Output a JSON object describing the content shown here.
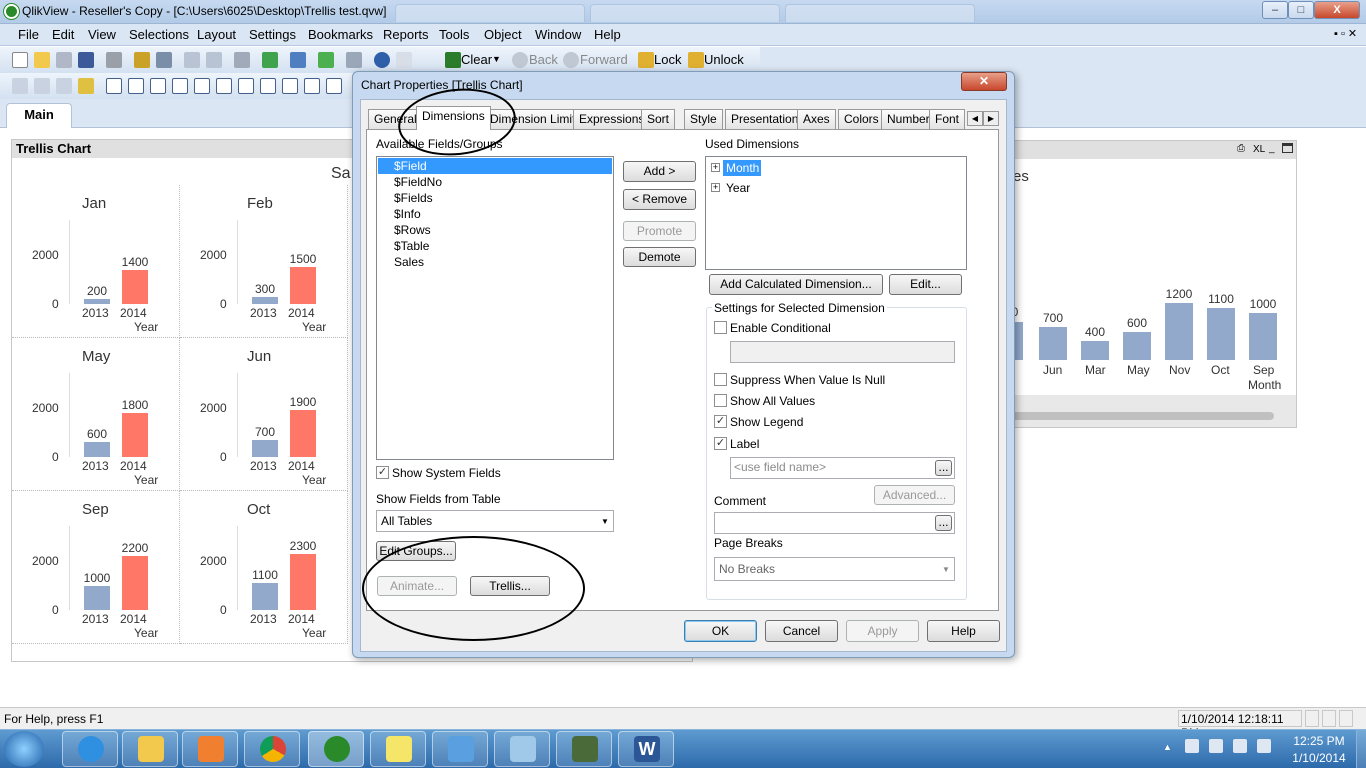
{
  "window": {
    "title": "QlikView - Reseller's Copy - [C:\\Users\\6025\\Desktop\\Trellis test.qvw]",
    "controls": {
      "minimize": "–",
      "maximize": "□",
      "close": "X"
    }
  },
  "menu": [
    "File",
    "Edit",
    "View",
    "Selections",
    "Layout",
    "Settings",
    "Bookmarks",
    "Reports",
    "Tools",
    "Object",
    "Window",
    "Help"
  ],
  "toolbar": {
    "clear": "Clear",
    "back": "Back",
    "forward": "Forward",
    "lock": "Lock",
    "unlock": "Unlock"
  },
  "sheet_tabs": [
    "Main"
  ],
  "trellis_object": {
    "title": "Trellis Chart",
    "partial_heading": "Sa",
    "x_axis_title": "Year",
    "cells": [
      {
        "month": "Jan",
        "values": [
          200,
          1400
        ]
      },
      {
        "month": "Feb",
        "values": [
          300,
          1500
        ]
      },
      {
        "month": "May",
        "values": [
          600,
          1800
        ]
      },
      {
        "month": "Jun",
        "values": [
          700,
          1900
        ]
      },
      {
        "month": "Sep",
        "values": [
          1000,
          2200
        ]
      },
      {
        "month": "Oct",
        "values": [
          1100,
          2300
        ]
      }
    ]
  },
  "chart_data": [
    {
      "type": "bar",
      "title": "Trellis Chart",
      "xlabel": "Year",
      "ylabel": "",
      "categories": [
        "2013",
        "2014"
      ],
      "y_ticks": [
        "0",
        "2000"
      ],
      "ylim": [
        0,
        2500
      ],
      "panels": [
        {
          "label": "Jan",
          "values": [
            200,
            1400
          ]
        },
        {
          "label": "Feb",
          "values": [
            300,
            1500
          ]
        },
        {
          "label": "May",
          "values": [
            600,
            1800
          ]
        },
        {
          "label": "Jun",
          "values": [
            700,
            1900
          ]
        },
        {
          "label": "Sep",
          "values": [
            1000,
            2200
          ]
        },
        {
          "label": "Oct",
          "values": [
            1100,
            2300
          ]
        }
      ]
    },
    {
      "type": "bar",
      "title": "",
      "partial_title": "es",
      "xlabel": "Month",
      "ylabel": "",
      "categories": [
        "l",
        "Jun",
        "Mar",
        "May",
        "Nov",
        "Oct",
        "Sep"
      ],
      "values": [
        null,
        700,
        400,
        600,
        1200,
        1100,
        1000
      ],
      "value_labels": [
        "0",
        "700",
        "400",
        "600",
        "1200",
        "1100",
        "1000"
      ],
      "ylim": [
        0,
        1500
      ]
    }
  ],
  "right_chart_header": {
    "xl": "XL"
  },
  "dialog": {
    "title": "Chart Properties [Trellis Chart]",
    "tabs": [
      "General",
      "Dimensions",
      "Dimension Limits",
      "Expressions",
      "Sort",
      "Style",
      "Presentation",
      "Axes",
      "Colors",
      "Number",
      "Font"
    ],
    "selected_tab": "Dimensions",
    "available_label": "Available Fields/Groups",
    "available_fields": [
      "$Field",
      "$FieldNo",
      "$Fields",
      "$Info",
      "$Rows",
      "$Table",
      "Sales"
    ],
    "selected_field": "$Field",
    "buttons": {
      "add": "Add >",
      "remove": "< Remove",
      "promote": "Promote",
      "demote": "Demote",
      "add_calc": "Add Calculated Dimension...",
      "edit": "Edit...",
      "advanced": "Advanced...",
      "ellipsis": "...",
      "edit_groups": "Edit Groups...",
      "animate": "Animate...",
      "trellis": "Trellis...",
      "ok": "OK",
      "cancel": "Cancel",
      "apply": "Apply",
      "help": "Help"
    },
    "used_label": "Used Dimensions",
    "used_dimensions": [
      "Month",
      "Year"
    ],
    "settings_title": "Settings for Selected Dimension",
    "enable_conditional": "Enable Conditional",
    "suppress_null": "Suppress When Value Is Null",
    "show_all_values": "Show All Values",
    "show_legend": "Show Legend",
    "label": "Label",
    "label_placeholder": "<use field name>",
    "comment": "Comment",
    "page_breaks": "Page Breaks",
    "page_breaks_value": "No Breaks",
    "show_system_fields": "Show System Fields",
    "show_fields_from": "Show Fields from Table",
    "table_value": "All Tables"
  },
  "status": {
    "help": "For Help, press F1",
    "timestamp": "1/10/2014 12:18:11 PM"
  },
  "taskbar": {
    "time": "12:25 PM",
    "date": "1/10/2014"
  },
  "colors": {
    "bar2013": "#92a9cc",
    "bar2014": "#ff7766",
    "selection": "#3399ff",
    "taskbar": "#2d6aab"
  }
}
